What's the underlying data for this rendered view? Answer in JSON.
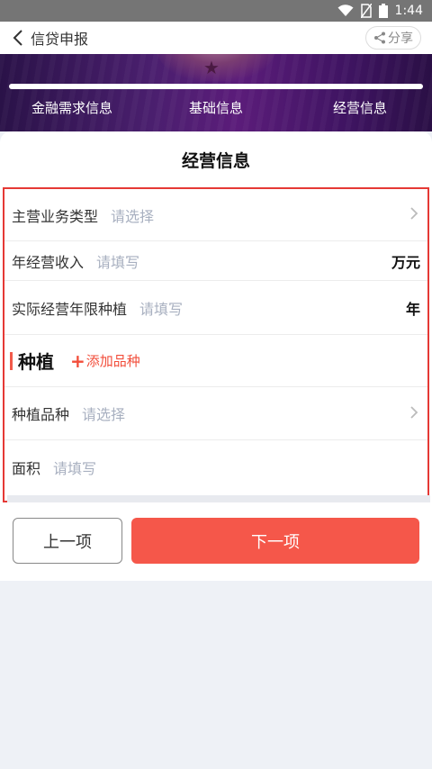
{
  "status_bar": {
    "time": "1:44"
  },
  "nav": {
    "title": "信贷申报",
    "share_label": "分享"
  },
  "steps": {
    "tabs": [
      "金融需求信息",
      "基础信息",
      "经营信息"
    ]
  },
  "section": {
    "title": "经营信息"
  },
  "form": {
    "business_type": {
      "label": "主营业务类型",
      "placeholder": "请选择"
    },
    "annual_income": {
      "label": "年经营收入",
      "placeholder": "请填写",
      "unit": "万元"
    },
    "years": {
      "label": "实际经营年限种植",
      "placeholder": "请填写",
      "unit": "年"
    },
    "group": {
      "title": "种植",
      "add_label": "添加品种"
    },
    "variety": {
      "label": "种植品种",
      "placeholder": "请选择"
    },
    "area": {
      "label": "面积",
      "placeholder": "请填写"
    }
  },
  "actions": {
    "prev_label": "上一项",
    "next_label": "下一项"
  },
  "colors": {
    "accent": "#f5574a",
    "highlight_border": "#e53935",
    "banner": "#4a1f6e",
    "placeholder": "#a8b0c0"
  }
}
